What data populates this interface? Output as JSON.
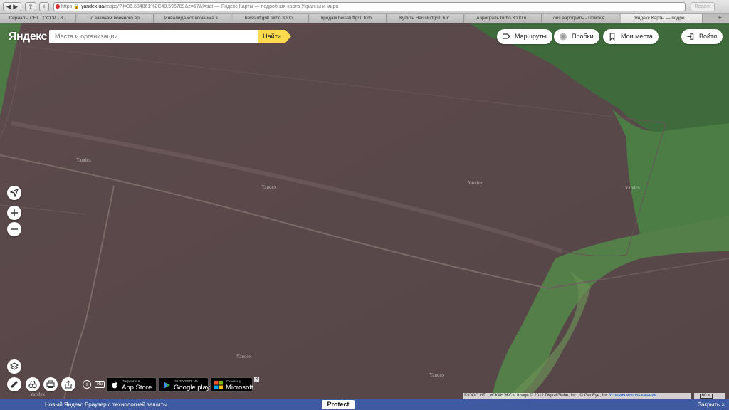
{
  "browser": {
    "url_protocol": "https",
    "url_host": "yandex.ua",
    "url_rest": "/maps/?ll=36.684861%2C49.596789&z=17&l=sat — Яндекс.Карты — подробная карта Украины и мира",
    "reader_label": "Reader",
    "tabs": [
      "Сериалы СНГ / СССР - 8...",
      "По законам военного вр...",
      "Инвалида-колясочника з...",
      "heissluftgrill turbo 3000...",
      "продам heissluftgrill turb...",
      "Купить Heissluftgrill Tur...",
      "Аэрогриль turbo 3000 п...",
      "ons аэрогриль - Поиск в...",
      "Яндекс.Карты — подро..."
    ]
  },
  "header": {
    "logo": "Яндекс",
    "search_placeholder": "Места и организации",
    "search_button": "Найти",
    "routes_label": "Маршруты",
    "traffic_label": "Пробки",
    "my_places_label": "Мои места",
    "login_label": "Войти"
  },
  "map": {
    "watermark": "Yandex",
    "copyright": "© ООО ИТЦ «СКАНЭКС», Image © 2012 DigitalGlobe, Inc., © GeoEye, Inc",
    "terms_link": "Условия использования",
    "scale_label": "60 м"
  },
  "footer": {
    "lang_label": "Ru",
    "app_store_small": "Загрузите в",
    "app_store_big": "App Store",
    "google_play_small": "ЗАГРУЗИТЕ НА",
    "google_play_big": "Google play",
    "microsoft_small": "Скачать у",
    "microsoft_big": "Microsoft",
    "close_glyph": "✕"
  },
  "banner": {
    "message": "Новый Яндекс.Браузер с технологией защиты",
    "protect_label": "Protect",
    "close_label": "Закрыть"
  }
}
